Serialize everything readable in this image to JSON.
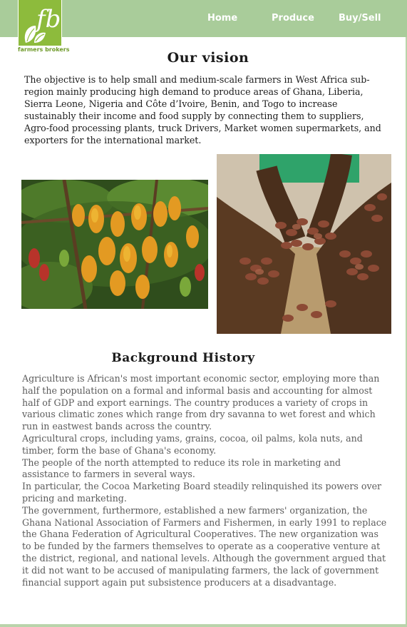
{
  "brand": {
    "logo_letters": "fb",
    "name": "farmers brokers"
  },
  "nav": {
    "home": "Home",
    "produce": "Produce",
    "buysell": "Buy/Sell"
  },
  "vision": {
    "title": "Our vision",
    "text": "The objective is to help small and medium-scale farmers in West Africa sub-region mainly producing high demand to produce areas of Ghana, Liberia, Sierra Leone, Nigeria and Côte d’Ivoire, Benin, and Togo to increase sustainably their income and food supply by connecting them to suppliers, Agro-food processing plants, truck Drivers, Market women supermarkets, and exporters for the international market."
  },
  "history": {
    "title": "Background History",
    "paragraphs": [
      "Agriculture is African's most important economic sector, employing more than half the population on a formal and informal basis and accounting for almost half of GDP and export earnings. The country produces a variety of crops in various climatic zones which range from dry savanna to wet forest and which run in eastwest bands across the country.",
      "Agricultural crops, including yams, grains, cocoa, oil palms, kola nuts, and timber, form the base of Ghana's economy.",
      "The people of the north attempted to reduce its role in marketing and assistance to farmers in several ways.",
      "In particular, the Cocoa Marketing Board steadily relinquished its powers over pricing and marketing.",
      "The government, furthermore, established a new farmers' organization, the Ghana National Association of Farmers and Fishermen, in early 1991 to replace the Ghana Federation of Agricultural Cooperatives. The new organization was to be funded by the farmers themselves to operate as a cooperative venture at the district, regional, and national levels. Although the government argued that it did not want to be accused of manipulating farmers, the lack of government financial support again put subsistence producers at a disadvantage."
    ]
  },
  "colors": {
    "nav_bg": "#a9cc9a",
    "logo_green": "#8dbb3c",
    "body_text": "#5b5b5b"
  },
  "images": [
    "cocoa-tree-photo",
    "cocoa-beans-in-hands-photo"
  ]
}
